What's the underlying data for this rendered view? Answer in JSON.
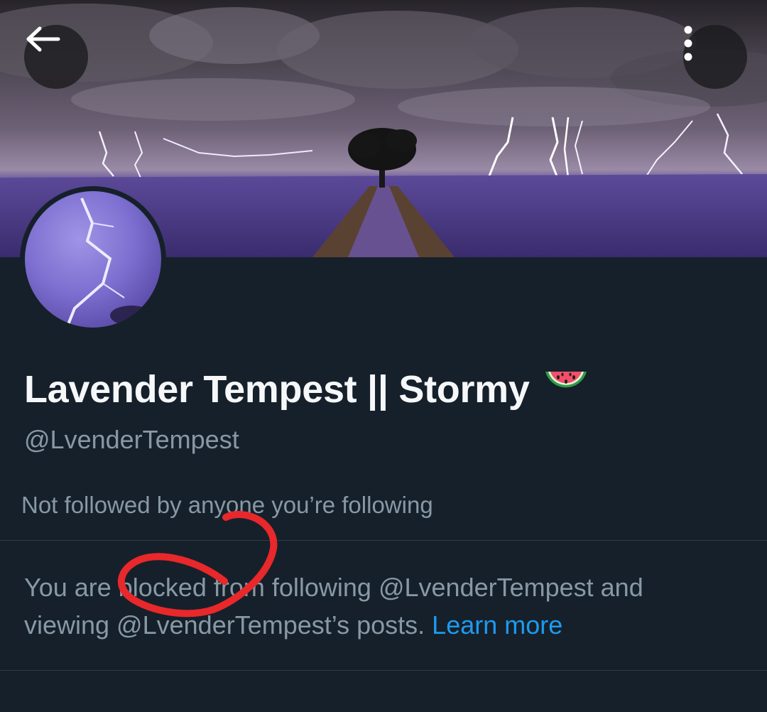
{
  "header": {
    "back_icon": "arrow-left-icon",
    "more_icon": "vertical-ellipsis-icon"
  },
  "profile": {
    "display_name": "Lavender Tempest || Stormy",
    "name_emoji": "watermelon-icon",
    "handle": "@LvenderTempest",
    "followed_by": "Not followed by anyone you’re following"
  },
  "notice": {
    "line1": "You are blocked from following @LvenderTempest and",
    "line2": "viewing @LvenderTempest’s posts.",
    "learn_more": "Learn more"
  },
  "colors": {
    "background": "#16202a",
    "primary_text": "#f5f7f9",
    "secondary_text": "#8899a6",
    "link": "#1d9bf0",
    "annotation": "#e8282a"
  }
}
